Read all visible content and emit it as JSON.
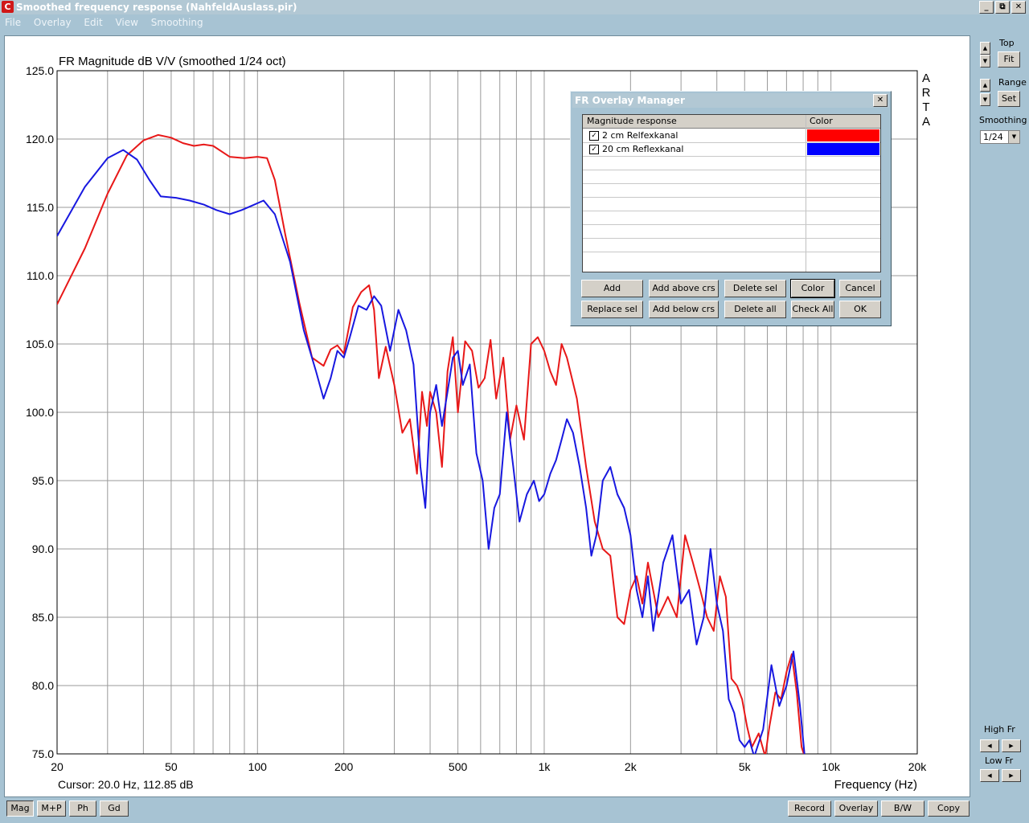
{
  "window": {
    "title": "Smoothed frequency response (NahfeldAuslass.pir)",
    "icon": "arta-app-icon",
    "controls": [
      "_",
      "⧉",
      "✕"
    ]
  },
  "menu": [
    "File",
    "Overlay",
    "Edit",
    "View",
    "Smoothing"
  ],
  "chart_data": {
    "type": "line",
    "title": "FR Magnitude dB V/V (smoothed 1/24 oct)",
    "xlabel": "Frequency (Hz)",
    "ylabel": "",
    "x_scale": "log",
    "xlim": [
      20,
      20000
    ],
    "ylim": [
      75,
      125
    ],
    "grid": true,
    "x_tick_labels": [
      {
        "f": 20,
        "label": "20"
      },
      {
        "f": 50,
        "label": "50"
      },
      {
        "f": 100,
        "label": "100"
      },
      {
        "f": 200,
        "label": "200"
      },
      {
        "f": 500,
        "label": "500"
      },
      {
        "f": 1000,
        "label": "1k"
      },
      {
        "f": 2000,
        "label": "2k"
      },
      {
        "f": 5000,
        "label": "5k"
      },
      {
        "f": 10000,
        "label": "10k"
      },
      {
        "f": 20000,
        "label": "20k"
      }
    ],
    "y_tick_labels": [
      "75.0",
      "80.0",
      "85.0",
      "90.0",
      "95.0",
      "100.0",
      "105.0",
      "110.0",
      "115.0",
      "120.0",
      "125.0"
    ],
    "y_ticks": [
      75,
      80,
      85,
      90,
      95,
      100,
      105,
      110,
      115,
      120,
      125
    ],
    "watermark": "A R T A",
    "cursor_text": "Cursor: 20.0 Hz, 112.85 dB",
    "series": [
      {
        "name": "2 cm Relfexkanal",
        "color": "#e81818",
        "points": [
          [
            20,
            107.9
          ],
          [
            25,
            112
          ],
          [
            30,
            116
          ],
          [
            35,
            118.8
          ],
          [
            40,
            119.9
          ],
          [
            45,
            120.3
          ],
          [
            50,
            120.1
          ],
          [
            55,
            119.7
          ],
          [
            60,
            119.5
          ],
          [
            65,
            119.6
          ],
          [
            70,
            119.5
          ],
          [
            80,
            118.7
          ],
          [
            90,
            118.6
          ],
          [
            100,
            118.7
          ],
          [
            108,
            118.6
          ],
          [
            115,
            117
          ],
          [
            125,
            113
          ],
          [
            140,
            108
          ],
          [
            155,
            104
          ],
          [
            170,
            103.4
          ],
          [
            180,
            104.6
          ],
          [
            190,
            104.9
          ],
          [
            200,
            104.3
          ],
          [
            215,
            107.7
          ],
          [
            230,
            108.8
          ],
          [
            245,
            109.3
          ],
          [
            255,
            107.5
          ],
          [
            265,
            102.5
          ],
          [
            280,
            104.8
          ],
          [
            300,
            102
          ],
          [
            320,
            98.5
          ],
          [
            340,
            99.5
          ],
          [
            360,
            95.5
          ],
          [
            375,
            101.5
          ],
          [
            390,
            99
          ],
          [
            400,
            101.5
          ],
          [
            420,
            100
          ],
          [
            440,
            96
          ],
          [
            460,
            103
          ],
          [
            480,
            105.5
          ],
          [
            500,
            100
          ],
          [
            530,
            105.2
          ],
          [
            560,
            104.5
          ],
          [
            590,
            101.8
          ],
          [
            620,
            102.5
          ],
          [
            650,
            105.3
          ],
          [
            680,
            101
          ],
          [
            720,
            104
          ],
          [
            760,
            98
          ],
          [
            800,
            100.5
          ],
          [
            850,
            98
          ],
          [
            900,
            105
          ],
          [
            950,
            105.5
          ],
          [
            1000,
            104.5
          ],
          [
            1050,
            103
          ],
          [
            1100,
            102
          ],
          [
            1150,
            105
          ],
          [
            1200,
            104
          ],
          [
            1300,
            101
          ],
          [
            1400,
            96
          ],
          [
            1500,
            92
          ],
          [
            1600,
            90
          ],
          [
            1700,
            89.5
          ],
          [
            1800,
            85
          ],
          [
            1900,
            84.5
          ],
          [
            2000,
            87
          ],
          [
            2100,
            88
          ],
          [
            2200,
            86
          ],
          [
            2300,
            89
          ],
          [
            2500,
            85
          ],
          [
            2700,
            86.5
          ],
          [
            2900,
            85
          ],
          [
            3100,
            91
          ],
          [
            3300,
            89
          ],
          [
            3500,
            87
          ],
          [
            3700,
            85
          ],
          [
            3900,
            84
          ],
          [
            4100,
            88
          ],
          [
            4300,
            86.5
          ],
          [
            4500,
            80.5
          ],
          [
            4700,
            80
          ],
          [
            4900,
            79
          ],
          [
            5100,
            77
          ],
          [
            5300,
            75.5
          ],
          [
            5600,
            76.5
          ],
          [
            5900,
            74.8
          ],
          [
            6100,
            77
          ],
          [
            6400,
            79.5
          ],
          [
            6700,
            79
          ],
          [
            7000,
            81
          ],
          [
            7300,
            82.3
          ],
          [
            7600,
            79.5
          ],
          [
            7900,
            75.5
          ],
          [
            8100,
            74.8
          ]
        ]
      },
      {
        "name": "20 cm Reflexkanal",
        "color": "#1818e0",
        "points": [
          [
            20,
            112.9
          ],
          [
            25,
            116.5
          ],
          [
            30,
            118.6
          ],
          [
            34,
            119.2
          ],
          [
            38,
            118.5
          ],
          [
            42,
            117
          ],
          [
            46,
            115.8
          ],
          [
            52,
            115.7
          ],
          [
            58,
            115.5
          ],
          [
            65,
            115.2
          ],
          [
            72,
            114.8
          ],
          [
            80,
            114.5
          ],
          [
            88,
            114.8
          ],
          [
            95,
            115.1
          ],
          [
            105,
            115.5
          ],
          [
            115,
            114.5
          ],
          [
            130,
            111
          ],
          [
            145,
            106
          ],
          [
            160,
            103
          ],
          [
            170,
            101
          ],
          [
            180,
            102.5
          ],
          [
            190,
            104.5
          ],
          [
            200,
            104
          ],
          [
            210,
            105.5
          ],
          [
            225,
            107.8
          ],
          [
            240,
            107.5
          ],
          [
            255,
            108.5
          ],
          [
            270,
            107.8
          ],
          [
            290,
            104.5
          ],
          [
            310,
            107.5
          ],
          [
            330,
            106
          ],
          [
            350,
            103.5
          ],
          [
            370,
            96
          ],
          [
            385,
            93
          ],
          [
            400,
            100
          ],
          [
            420,
            102
          ],
          [
            440,
            99
          ],
          [
            460,
            101.5
          ],
          [
            480,
            104
          ],
          [
            500,
            104.5
          ],
          [
            520,
            102
          ],
          [
            550,
            103.5
          ],
          [
            580,
            97
          ],
          [
            610,
            95
          ],
          [
            640,
            90
          ],
          [
            670,
            93
          ],
          [
            700,
            94
          ],
          [
            740,
            100
          ],
          [
            780,
            96
          ],
          [
            820,
            92
          ],
          [
            870,
            94
          ],
          [
            920,
            95
          ],
          [
            960,
            93.5
          ],
          [
            1000,
            94
          ],
          [
            1050,
            95.5
          ],
          [
            1100,
            96.5
          ],
          [
            1150,
            98
          ],
          [
            1200,
            99.5
          ],
          [
            1260,
            98.5
          ],
          [
            1330,
            96
          ],
          [
            1400,
            93
          ],
          [
            1460,
            89.5
          ],
          [
            1520,
            91
          ],
          [
            1600,
            95
          ],
          [
            1700,
            96
          ],
          [
            1800,
            94
          ],
          [
            1900,
            93
          ],
          [
            2000,
            91
          ],
          [
            2100,
            87
          ],
          [
            2200,
            85
          ],
          [
            2300,
            88
          ],
          [
            2400,
            84
          ],
          [
            2600,
            89
          ],
          [
            2800,
            91
          ],
          [
            3000,
            86
          ],
          [
            3200,
            87
          ],
          [
            3400,
            83
          ],
          [
            3600,
            85
          ],
          [
            3800,
            90
          ],
          [
            4000,
            86
          ],
          [
            4200,
            84
          ],
          [
            4400,
            79
          ],
          [
            4600,
            78
          ],
          [
            4800,
            76
          ],
          [
            5000,
            75.5
          ],
          [
            5200,
            76
          ],
          [
            5400,
            74.8
          ],
          [
            5800,
            76.8
          ],
          [
            6200,
            81.5
          ],
          [
            6600,
            78.5
          ],
          [
            7000,
            80
          ],
          [
            7400,
            82.5
          ],
          [
            7800,
            78.5
          ],
          [
            8100,
            74.8
          ]
        ]
      }
    ]
  },
  "right_panel": {
    "top_label": "Top",
    "fit_label": "Fit",
    "range_label": "Range",
    "set_label": "Set",
    "smoothing_label": "Smoothing",
    "smoothing_value": "1/24",
    "high_fr_label": "High Fr",
    "low_fr_label": "Low Fr"
  },
  "bottom_buttons": {
    "left": [
      "Mag",
      "M+P",
      "Ph",
      "Gd"
    ],
    "right": [
      "Record",
      "Overlay",
      "B/W",
      "Copy"
    ]
  },
  "dialog": {
    "title": "FR Overlay Manager",
    "col_response": "Magnitude response",
    "col_color": "Color",
    "rows": [
      {
        "label": "2 cm Relfexkanal",
        "checked": "✓",
        "color": "#ff0000"
      },
      {
        "label": "20 cm Reflexkanal",
        "checked": "✓",
        "color": "#0000ff"
      }
    ],
    "buttons_row1": [
      "Add",
      "Add above crs",
      "Delete sel",
      "Color",
      "Cancel"
    ],
    "buttons_row2": [
      "Replace sel",
      "Add below crs",
      "Delete all",
      "Check All",
      "OK"
    ]
  }
}
